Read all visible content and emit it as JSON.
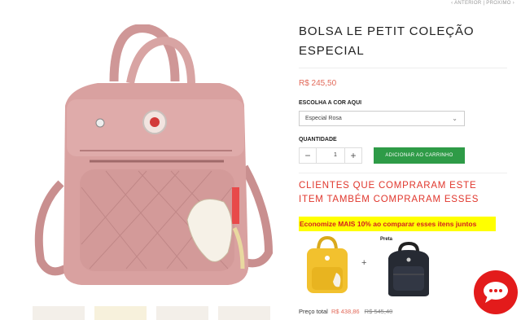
{
  "nav": {
    "prev": "ANTERIOR",
    "sep": "|",
    "next": "PRÓXIMO"
  },
  "product": {
    "title": "BOLSA LE PETIT COLEÇÃO ESPECIAL",
    "price": "R$ 245,50",
    "color_label": "ESCOLHA A COR AQUI",
    "color_value": "Especial Rosa",
    "qty_label": "QUANTIDADE",
    "qty_minus": "−",
    "qty_value": "1",
    "qty_plus": "+",
    "add_to_cart": "ADICIONAR AO CARRINHO"
  },
  "related": {
    "heading": "CLIENTES QUE COMPRARAM ESTE ITEM TAMBÉM COMPRARAM ESSES",
    "promo": "Economize MAIS 10% ao comparar esses itens juntos",
    "plus": "+",
    "item2_label": "Preta",
    "total_label": "Preço total",
    "total_new": "R$ 438,86",
    "total_old": "R$ 545,40"
  },
  "colors": {
    "accent": "#2e9b47",
    "price": "#e26a5a",
    "headline": "#e0362c",
    "chat": "#e31b1b",
    "promo_bg": "#ffff00",
    "bag_pink": "#d9a1a0"
  },
  "icons": [
    "chevron-down-icon",
    "chat-icon"
  ]
}
